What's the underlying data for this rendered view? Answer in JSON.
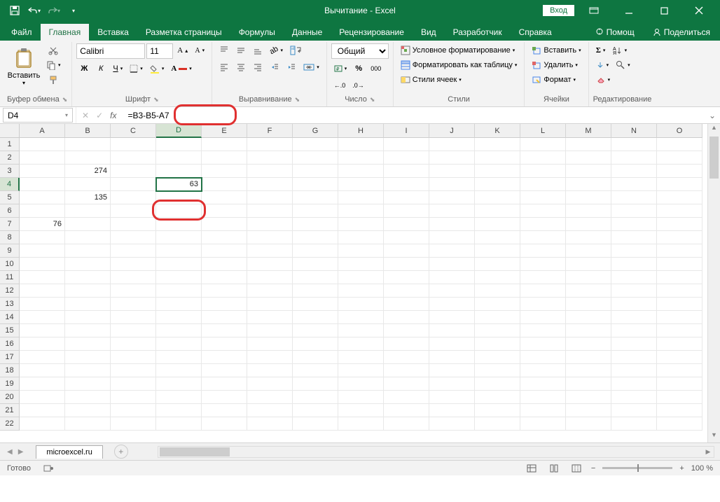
{
  "title": "Вычитание - Excel",
  "signin": "Вход",
  "tabs": [
    "Файл",
    "Главная",
    "Вставка",
    "Разметка страницы",
    "Формулы",
    "Данные",
    "Рецензирование",
    "Вид",
    "Разработчик",
    "Справка"
  ],
  "active_tab": 1,
  "help": "Помощ",
  "share": "Поделиться",
  "clipboard": {
    "paste": "Вставить",
    "label": "Буфер обмена"
  },
  "font": {
    "name": "Calibri",
    "size": "11",
    "bold": "Ж",
    "italic": "К",
    "underline": "Ч",
    "label": "Шрифт"
  },
  "align": {
    "label": "Выравнивание"
  },
  "number": {
    "format": "Общий",
    "label": "Число"
  },
  "styles": {
    "cond": "Условное форматирование",
    "table": "Форматировать как таблицу",
    "cell": "Стили ячеек",
    "label": "Стили"
  },
  "cellsg": {
    "insert": "Вставить",
    "delete": "Удалить",
    "format": "Формат",
    "label": "Ячейки"
  },
  "editing": {
    "label": "Редактирование"
  },
  "namebox": "D4",
  "formula": "=B3-B5-A7",
  "columns": [
    "A",
    "B",
    "C",
    "D",
    "E",
    "F",
    "G",
    "H",
    "I",
    "J",
    "K",
    "L",
    "M",
    "N",
    "O"
  ],
  "rows": 22,
  "selected_col": 3,
  "selected_row": 3,
  "data": {
    "B3": "274",
    "D4": "63",
    "B5": "135",
    "A7": "76"
  },
  "sheet": "microexcel.ru",
  "status": "Готово",
  "zoom": "100 %"
}
